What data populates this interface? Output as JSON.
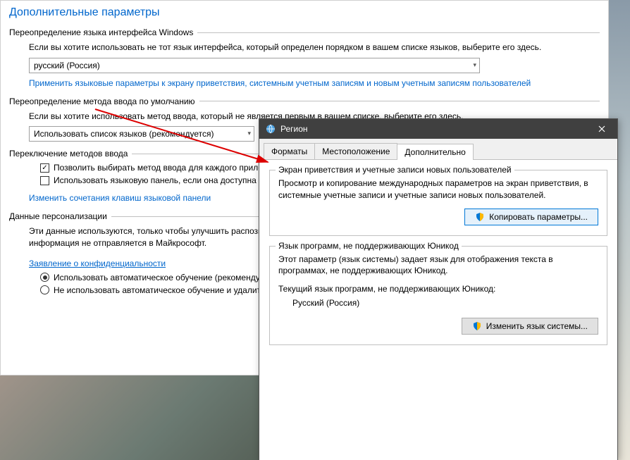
{
  "main": {
    "title": "Дополнительные параметры",
    "section1": {
      "header": "Переопределение языка интерфейса Windows",
      "desc": "Если вы хотите использовать не тот язык интерфейса, который определен порядком в вашем списке языков, выберите его здесь.",
      "dropdown_value": "русский (Россия)",
      "link": "Применить языковые параметры к экрану приветствия, системным учетным записям и новым учетным записям пользователей"
    },
    "section2": {
      "header": "Переопределение метода ввода по умолчанию",
      "desc": "Если вы хотите использовать метод ввода, который не является первым в вашем списке, выберите его здесь.",
      "dropdown_value": "Использовать список языков (рекомендуется)"
    },
    "section3": {
      "header": "Переключение методов ввода",
      "check1": "Позволить выбирать метод ввода для каждого приложения",
      "check2": "Использовать языковую панель, если она доступна",
      "link": "Изменить сочетания клавиш языковой панели"
    },
    "section4": {
      "header": "Данные персонализации",
      "desc": "Эти данные используются, только чтобы улучшить распознавание рукописного ввода и текста для языков без IME на этом компьютере. Никакая информация не отправляется в Майкрософт.",
      "link": "Заявление о конфиденциальности",
      "radio1": "Использовать автоматическое обучение (рекомендуется)",
      "radio2": "Не использовать автоматическое обучение и удалить ранее собранные данные"
    }
  },
  "dialog": {
    "title": "Регион",
    "tabs": {
      "t1": "Форматы",
      "t2": "Местоположение",
      "t3": "Дополнительно"
    },
    "group1": {
      "title": "Экран приветствия и учетные записи новых пользователей",
      "text": "Просмотр и копирование международных параметров на экран приветствия, в системные учетные записи и учетные записи новых пользователей.",
      "button": "Копировать параметры..."
    },
    "group2": {
      "title": "Язык программ, не поддерживающих Юникод",
      "text": "Этот параметр (язык системы) задает язык для отображения текста в программах, не поддерживающих Юникод.",
      "cur_label": "Текущий язык программ, не поддерживающих Юникод:",
      "cur_value": "Русский (Россия)",
      "button": "Изменить язык системы..."
    }
  }
}
